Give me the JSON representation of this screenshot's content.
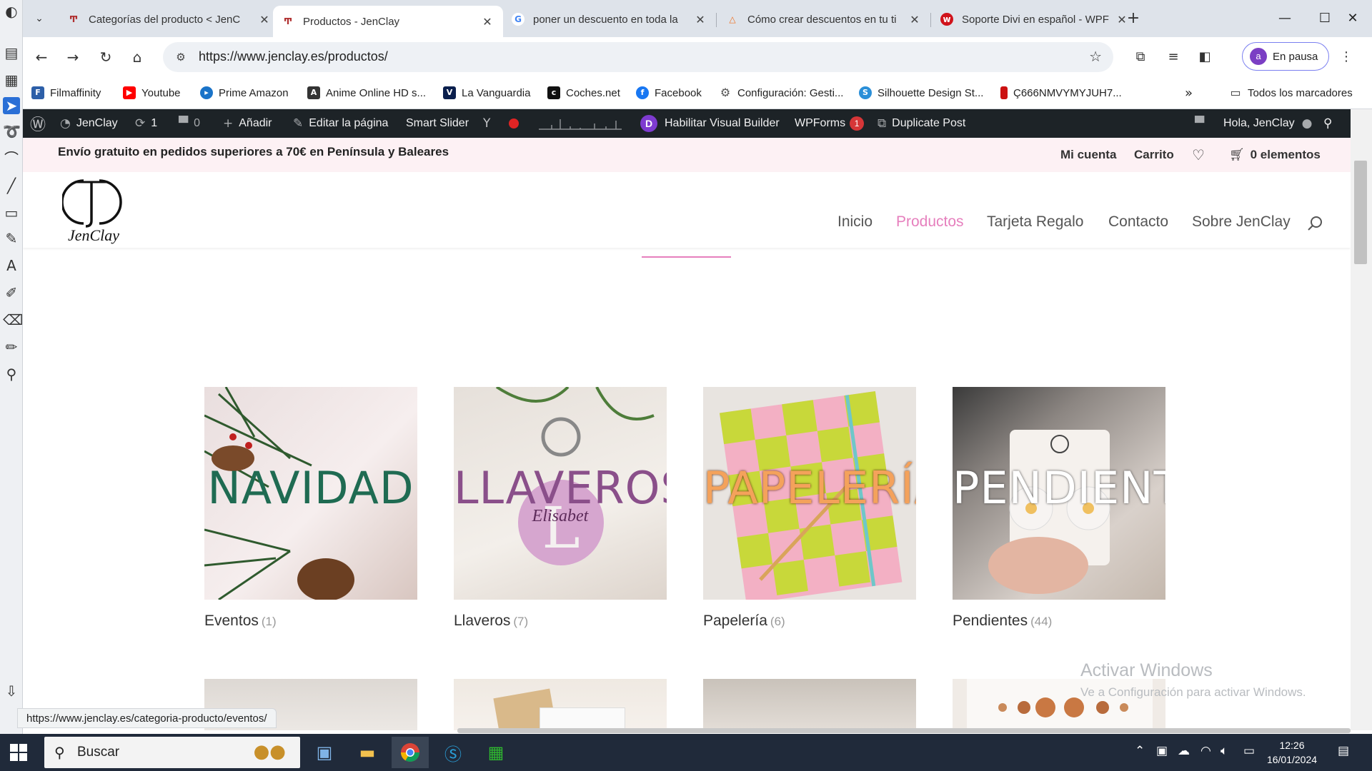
{
  "tabs": [
    {
      "title": "Categorías del producto < JenC",
      "favicon": "jenclay-logo",
      "active": false
    },
    {
      "title": "Productos - JenClay",
      "favicon": "jenclay-logo",
      "active": true
    },
    {
      "title": "poner un descuento en toda la",
      "favicon": "google-logo",
      "active": false
    },
    {
      "title": "Cómo crear descuentos en tu ti",
      "favicon": "warning-triangle",
      "active": false
    },
    {
      "title": "Soporte Divi en español - WPFa",
      "favicon": "wpfa-logo",
      "active": false
    }
  ],
  "address": {
    "url": "https://www.jenclay.es/productos/"
  },
  "profile": {
    "initial": "a",
    "label": "En pausa"
  },
  "bookmarks": [
    {
      "label": "Filmaffinity",
      "icon": "filmaffinity-icon",
      "color": "#2d5fa8"
    },
    {
      "label": "Youtube",
      "icon": "youtube-icon",
      "color": "#ff0000"
    },
    {
      "label": "Prime Amazon",
      "icon": "prime-icon",
      "color": "#1a73c8"
    },
    {
      "label": "Anime Online HD s...",
      "icon": "anime-icon",
      "color": "#333333"
    },
    {
      "label": "La Vanguardia",
      "icon": "vanguardia-icon",
      "color": "#0b1f4d"
    },
    {
      "label": "Coches.net",
      "icon": "coches-icon",
      "color": "#111111"
    },
    {
      "label": "Facebook",
      "icon": "facebook-icon",
      "color": "#1877f2"
    },
    {
      "label": "Configuración: Gesti...",
      "icon": "gear-icon",
      "color": "#555555"
    },
    {
      "label": "Silhouette Design St...",
      "icon": "silhouette-icon",
      "color": "#2a8fd8"
    },
    {
      "label": "Ç666NMVYMYJUH7...",
      "icon": "bookmark-red-icon",
      "color": "#cc1111"
    }
  ],
  "bookmarks_all": "Todos los marcadores",
  "wpbar": {
    "site": "JenClay",
    "updates": "1",
    "comments": "0",
    "add": "Añadir",
    "edit": "Editar la página",
    "slider": "Smart Slider",
    "visual_builder": "Habilitar Visual Builder",
    "wpforms": "WPForms",
    "wpforms_badge": "1",
    "duplicate": "Duplicate Post",
    "greeting": "Hola, JenClay"
  },
  "site": {
    "shipping_notice": "Envío gratuito en pedidos superiores a 70€ en Península y Baleares",
    "account": "Mi cuenta",
    "cart_link": "Carrito",
    "cart_items": "0 elementos",
    "logo_text": "JenClay",
    "nav": [
      {
        "label": "Inicio",
        "active": false
      },
      {
        "label": "Productos",
        "active": true
      },
      {
        "label": "Tarjeta Regalo",
        "active": false
      },
      {
        "label": "Contacto",
        "active": false
      },
      {
        "label": "Sobre JenClay",
        "active": false
      }
    ],
    "accent": "#e67fbd"
  },
  "categories": [
    {
      "name": "Eventos",
      "count": "(1)",
      "image_text": "NAVIDAD",
      "text_color": "#1f6b52"
    },
    {
      "name": "Llaveros",
      "count": "(7)",
      "image_text": "LLAVEROS",
      "text_color": "#8a4f8a",
      "badge": "Elisabet"
    },
    {
      "name": "Papelería",
      "count": "(6)",
      "image_text": "PAPELERÍA",
      "text_color": "#f4a25b"
    },
    {
      "name": "Pendientes",
      "count": "(44)",
      "image_text": "PENDIENTES",
      "text_color": "#ffffff"
    }
  ],
  "status_url": "https://www.jenclay.es/categoria-producto/eventos/",
  "watermark": {
    "title": "Activar Windows",
    "subtitle": "Ve a Configuración para activar Windows."
  },
  "taskbar": {
    "search": "Buscar",
    "time": "12:26",
    "date": "16/01/2024"
  }
}
